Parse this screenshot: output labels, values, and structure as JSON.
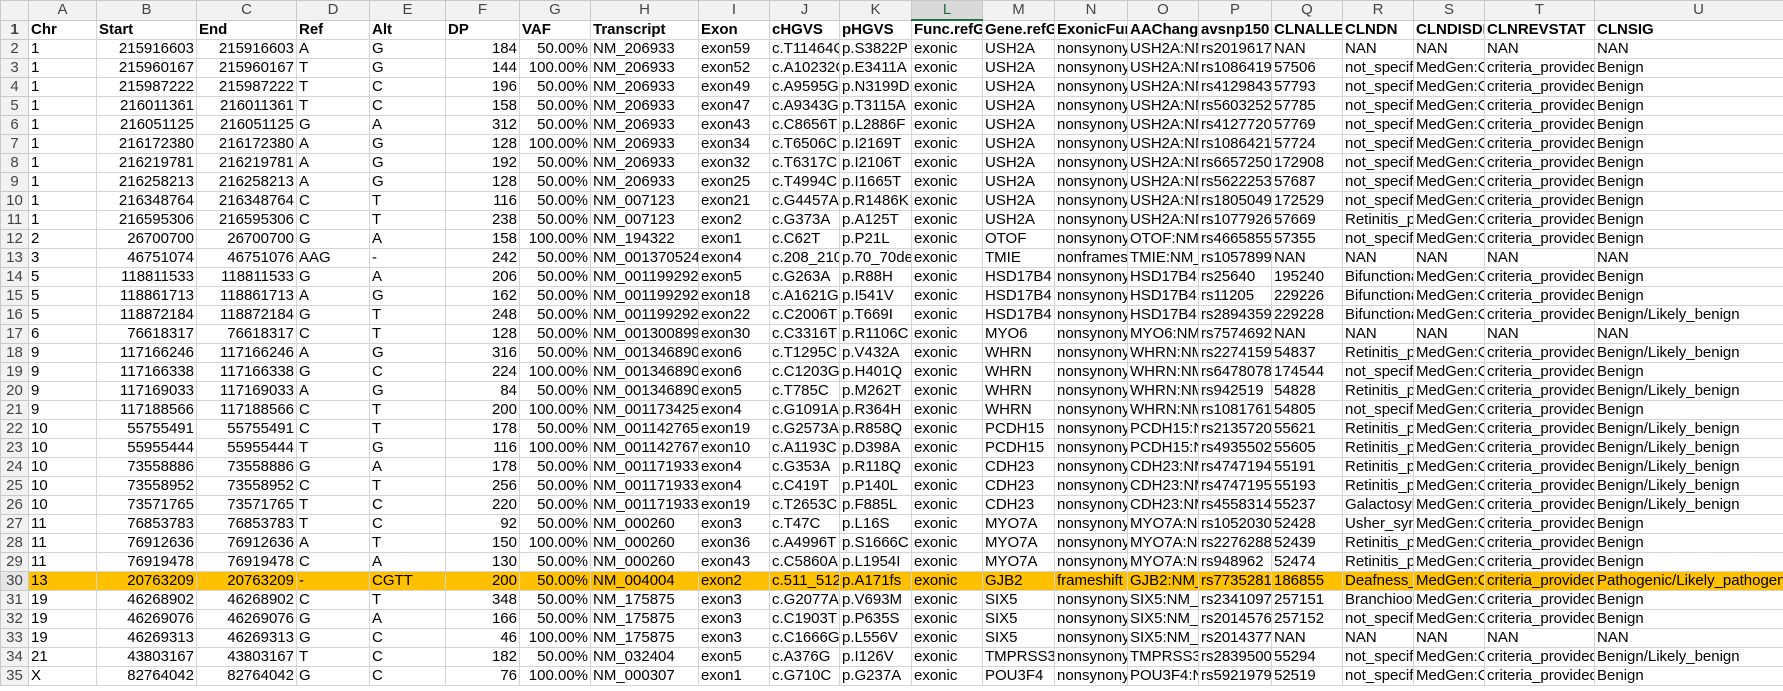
{
  "columns": [
    "A",
    "B",
    "C",
    "D",
    "E",
    "F",
    "G",
    "H",
    "I",
    "J",
    "K",
    "L",
    "M",
    "N",
    "O",
    "P",
    "Q",
    "R",
    "S",
    "T",
    "U"
  ],
  "selected_column": "L",
  "highlight_row": 30,
  "highlight_color": "#ffc000",
  "numeric_columns": [
    1,
    2,
    5,
    6
  ],
  "rows": [
    [
      "Chr",
      "Start",
      "End",
      "Ref",
      "Alt",
      "DP",
      "VAF",
      "Transcript",
      "Exon",
      "cHGVS",
      "pHGVS",
      "Func.refGe",
      "Gene.refGe",
      "ExonicFun",
      "AAChange",
      "avsnp150",
      "CLNALLEL",
      "CLNDN",
      "CLNDISDB",
      "CLNREVSTAT",
      "CLNSIG"
    ],
    [
      "1",
      "215916603",
      "215916603",
      "A",
      "G",
      "184",
      "50.00%",
      "NM_206933",
      "exon59",
      "c.T11464C",
      "p.S3822P",
      "exonic",
      "USH2A",
      "nonsynony",
      "USH2A:NM",
      "rs2019617",
      "NAN",
      "NAN",
      "NAN",
      "NAN",
      "NAN"
    ],
    [
      "1",
      "215960167",
      "215960167",
      "T",
      "G",
      "144",
      "100.00%",
      "NM_206933",
      "exon52",
      "c.A10232C",
      "p.E3411A",
      "exonic",
      "USH2A",
      "nonsynony",
      "USH2A:NM",
      "rs1086419",
      "57506",
      "not_specifi",
      "MedGen:C",
      "criteria_provided",
      "Benign"
    ],
    [
      "1",
      "215987222",
      "215987222",
      "T",
      "C",
      "196",
      "50.00%",
      "NM_206933",
      "exon49",
      "c.A9595G",
      "p.N3199D",
      "exonic",
      "USH2A",
      "nonsynony",
      "USH2A:NM",
      "rs4129843",
      "57793",
      "not_specifi",
      "MedGen:C",
      "criteria_provided",
      "Benign"
    ],
    [
      "1",
      "216011361",
      "216011361",
      "T",
      "C",
      "158",
      "50.00%",
      "NM_206933",
      "exon47",
      "c.A9343G",
      "p.T3115A",
      "exonic",
      "USH2A",
      "nonsynony",
      "USH2A:NM",
      "rs5603252",
      "57785",
      "not_specifi",
      "MedGen:C",
      "criteria_provided",
      "Benign"
    ],
    [
      "1",
      "216051125",
      "216051125",
      "G",
      "A",
      "312",
      "50.00%",
      "NM_206933",
      "exon43",
      "c.C8656T",
      "p.L2886F",
      "exonic",
      "USH2A",
      "nonsynony",
      "USH2A:NM",
      "rs4127720",
      "57769",
      "not_specifi",
      "MedGen:C",
      "criteria_provided",
      "Benign"
    ],
    [
      "1",
      "216172380",
      "216172380",
      "A",
      "G",
      "128",
      "100.00%",
      "NM_206933",
      "exon34",
      "c.T6506C",
      "p.I2169T",
      "exonic",
      "USH2A",
      "nonsynony",
      "USH2A:NM",
      "rs1086421",
      "57724",
      "not_specifi",
      "MedGen:C",
      "criteria_provided",
      "Benign"
    ],
    [
      "1",
      "216219781",
      "216219781",
      "A",
      "G",
      "192",
      "50.00%",
      "NM_206933",
      "exon32",
      "c.T6317C",
      "p.I2106T",
      "exonic",
      "USH2A",
      "nonsynony",
      "USH2A:NM",
      "rs6657250",
      "172908",
      "not_specifi",
      "MedGen:C",
      "criteria_provided",
      "Benign"
    ],
    [
      "1",
      "216258213",
      "216258213",
      "A",
      "G",
      "128",
      "50.00%",
      "NM_206933",
      "exon25",
      "c.T4994C",
      "p.I1665T",
      "exonic",
      "USH2A",
      "nonsynony",
      "USH2A:NM",
      "rs5622253",
      "57687",
      "not_specifi",
      "MedGen:C",
      "criteria_provided",
      "Benign"
    ],
    [
      "1",
      "216348764",
      "216348764",
      "C",
      "T",
      "116",
      "50.00%",
      "NM_007123",
      "exon21",
      "c.G4457A",
      "p.R1486K",
      "exonic",
      "USH2A",
      "nonsynony",
      "USH2A:NM",
      "rs1805049",
      "172529",
      "not_specifi",
      "MedGen:C",
      "criteria_provided",
      "Benign"
    ],
    [
      "1",
      "216595306",
      "216595306",
      "C",
      "T",
      "238",
      "50.00%",
      "NM_007123",
      "exon2",
      "c.G373A",
      "p.A125T",
      "exonic",
      "USH2A",
      "nonsynony",
      "USH2A:NM",
      "rs1077926",
      "57669",
      "Retinitis_pi",
      "MedGen:C",
      "criteria_provided",
      "Benign"
    ],
    [
      "2",
      "26700700",
      "26700700",
      "G",
      "A",
      "158",
      "100.00%",
      "NM_194322",
      "exon1",
      "c.C62T",
      "p.P21L",
      "exonic",
      "OTOF",
      "nonsynony",
      "OTOF:NM_",
      "rs4665855",
      "57355",
      "not_specifi",
      "MedGen:C",
      "criteria_provided",
      "Benign"
    ],
    [
      "3",
      "46751074",
      "46751076",
      "AAG",
      "-",
      "242",
      "50.00%",
      "NM_001370524",
      "exon4",
      "c.208_210d",
      "p.70_70del",
      "exonic",
      "TMIE",
      "nonframes",
      "TMIE:NM_",
      "rs1057899",
      "NAN",
      "NAN",
      "NAN",
      "NAN",
      "NAN"
    ],
    [
      "5",
      "118811533",
      "118811533",
      "G",
      "A",
      "206",
      "50.00%",
      "NM_001199292",
      "exon5",
      "c.G263A",
      "p.R88H",
      "exonic",
      "HSD17B4",
      "nonsynony",
      "HSD17B4:N",
      "rs25640",
      "195240",
      "Bifunctiona",
      "MedGen:C",
      "criteria_provided",
      "Benign"
    ],
    [
      "5",
      "118861713",
      "118861713",
      "A",
      "G",
      "162",
      "50.00%",
      "NM_001199292",
      "exon18",
      "c.A1621G",
      "p.I541V",
      "exonic",
      "HSD17B4",
      "nonsynony",
      "HSD17B4:N",
      "rs11205",
      "229226",
      "Bifunctiona",
      "MedGen:C",
      "criteria_provided",
      "Benign"
    ],
    [
      "5",
      "118872184",
      "118872184",
      "G",
      "T",
      "248",
      "50.00%",
      "NM_001199292",
      "exon22",
      "c.C2006T",
      "p.T669I",
      "exonic",
      "HSD17B4",
      "nonsynony",
      "HSD17B4:N",
      "rs2894359",
      "229228",
      "Bifunctiona",
      "MedGen:C",
      "criteria_provided",
      "Benign/Likely_benign"
    ],
    [
      "6",
      "76618317",
      "76618317",
      "C",
      "T",
      "128",
      "50.00%",
      "NM_001300899",
      "exon30",
      "c.C3316T",
      "p.R1106C",
      "exonic",
      "MYO6",
      "nonsynony",
      "MYO6:NM_",
      "rs7574692",
      "NAN",
      "NAN",
      "NAN",
      "NAN",
      "NAN"
    ],
    [
      "9",
      "117166246",
      "117166246",
      "A",
      "G",
      "316",
      "50.00%",
      "NM_001346890",
      "exon6",
      "c.T1295C",
      "p.V432A",
      "exonic",
      "WHRN",
      "nonsynony",
      "WHRN:NM",
      "rs2274159",
      "54837",
      "Retinitis_pi",
      "MedGen:C",
      "criteria_provided",
      "Benign/Likely_benign"
    ],
    [
      "9",
      "117166338",
      "117166338",
      "G",
      "C",
      "224",
      "100.00%",
      "NM_001346890",
      "exon6",
      "c.C1203G",
      "p.H401Q",
      "exonic",
      "WHRN",
      "nonsynony",
      "WHRN:NM",
      "rs6478078",
      "174544",
      "not_specifi",
      "MedGen:C",
      "criteria_provided",
      "Benign"
    ],
    [
      "9",
      "117169033",
      "117169033",
      "A",
      "G",
      "84",
      "50.00%",
      "NM_001346890",
      "exon5",
      "c.T785C",
      "p.M262T",
      "exonic",
      "WHRN",
      "nonsynony",
      "WHRN:NM",
      "rs942519",
      "54828",
      "Retinitis_pi",
      "MedGen:C",
      "criteria_provided",
      "Benign/Likely_benign"
    ],
    [
      "9",
      "117188566",
      "117188566",
      "C",
      "T",
      "200",
      "100.00%",
      "NM_001173425",
      "exon4",
      "c.G1091A",
      "p.R364H",
      "exonic",
      "WHRN",
      "nonsynony",
      "WHRN:NM",
      "rs1081761",
      "54805",
      "not_specifi",
      "MedGen:C",
      "criteria_provided",
      "Benign"
    ],
    [
      "10",
      "55755491",
      "55755491",
      "C",
      "T",
      "178",
      "50.00%",
      "NM_001142765",
      "exon19",
      "c.G2573A",
      "p.R858Q",
      "exonic",
      "PCDH15",
      "nonsynony",
      "PCDH15:NM",
      "rs2135720",
      "55621",
      "Retinitis_pi",
      "MedGen:C",
      "criteria_provided",
      "Benign/Likely_benign"
    ],
    [
      "10",
      "55955444",
      "55955444",
      "T",
      "G",
      "116",
      "100.00%",
      "NM_001142767",
      "exon10",
      "c.A1193C",
      "p.D398A",
      "exonic",
      "PCDH15",
      "nonsynony",
      "PCDH15:NM",
      "rs4935502",
      "55605",
      "Retinitis_pi",
      "MedGen:C",
      "criteria_provided",
      "Benign/Likely_benign"
    ],
    [
      "10",
      "73558886",
      "73558886",
      "G",
      "A",
      "178",
      "50.00%",
      "NM_001171933",
      "exon4",
      "c.G353A",
      "p.R118Q",
      "exonic",
      "CDH23",
      "nonsynony",
      "CDH23:NM",
      "rs4747194",
      "55191",
      "Retinitis_pi",
      "MedGen:C",
      "criteria_provided",
      "Benign/Likely_benign"
    ],
    [
      "10",
      "73558952",
      "73558952",
      "C",
      "T",
      "256",
      "50.00%",
      "NM_001171933",
      "exon4",
      "c.C419T",
      "p.P140L",
      "exonic",
      "CDH23",
      "nonsynony",
      "CDH23:NM",
      "rs4747195",
      "55193",
      "Retinitis_pi",
      "MedGen:C",
      "criteria_provided",
      "Benign/Likely_benign"
    ],
    [
      "10",
      "73571765",
      "73571765",
      "T",
      "C",
      "220",
      "50.00%",
      "NM_001171933",
      "exon19",
      "c.T2653C",
      "p.F885L",
      "exonic",
      "CDH23",
      "nonsynony",
      "CDH23:NM",
      "rs4558314",
      "55237",
      "Galactosyl",
      "MedGen:C",
      "criteria_provided",
      "Benign/Likely_benign"
    ],
    [
      "11",
      "76853783",
      "76853783",
      "T",
      "C",
      "92",
      "50.00%",
      "NM_000260",
      "exon3",
      "c.T47C",
      "p.L16S",
      "exonic",
      "MYO7A",
      "nonsynony",
      "MYO7A:NM",
      "rs1052030",
      "52428",
      "Usher_synd",
      "MedGen:C",
      "criteria_provided",
      "Benign"
    ],
    [
      "11",
      "76912636",
      "76912636",
      "A",
      "T",
      "150",
      "100.00%",
      "NM_000260",
      "exon36",
      "c.A4996T",
      "p.S1666C",
      "exonic",
      "MYO7A",
      "nonsynony",
      "MYO7A:NM",
      "rs2276288",
      "52439",
      "Retinitis_pi",
      "MedGen:C",
      "criteria_provided",
      "Benign"
    ],
    [
      "11",
      "76919478",
      "76919478",
      "C",
      "A",
      "130",
      "50.00%",
      "NM_000260",
      "exon43",
      "c.C5860A",
      "p.L1954I",
      "exonic",
      "MYO7A",
      "nonsynony",
      "MYO7A:NM",
      "rs948962",
      "52474",
      "Retinitis_pi",
      "MedGen:C",
      "criteria_provided",
      "Benign"
    ],
    [
      "13",
      "20763209",
      "20763209",
      "-",
      "CGTT",
      "200",
      "50.00%",
      "NM_004004",
      "exon2",
      "c.511_512i",
      "p.A171fs",
      "exonic",
      "GJB2",
      "frameshift",
      "GJB2:NM_0",
      "rs7735281",
      "186855",
      "Deafness_",
      "MedGen:C",
      "criteria_provided",
      "Pathogenic/Likely_pathogenic"
    ],
    [
      "19",
      "46268902",
      "46268902",
      "C",
      "T",
      "348",
      "50.00%",
      "NM_175875",
      "exon3",
      "c.G2077A",
      "p.V693M",
      "exonic",
      "SIX5",
      "nonsynony",
      "SIX5:NM_1",
      "rs2341097",
      "257151",
      "Branchioot",
      "MedGen:C",
      "criteria_provided",
      "Benign"
    ],
    [
      "19",
      "46269076",
      "46269076",
      "G",
      "A",
      "166",
      "50.00%",
      "NM_175875",
      "exon3",
      "c.C1903T",
      "p.P635S",
      "exonic",
      "SIX5",
      "nonsynony",
      "SIX5:NM_1",
      "rs2014576",
      "257152",
      "not_specifi",
      "MedGen:C",
      "criteria_provided",
      "Benign"
    ],
    [
      "19",
      "46269313",
      "46269313",
      "G",
      "C",
      "46",
      "100.00%",
      "NM_175875",
      "exon3",
      "c.C1666G",
      "p.L556V",
      "exonic",
      "SIX5",
      "nonsynony",
      "SIX5:NM_1",
      "rs2014377",
      "NAN",
      "NAN",
      "NAN",
      "NAN",
      "NAN"
    ],
    [
      "21",
      "43803167",
      "43803167",
      "T",
      "C",
      "182",
      "50.00%",
      "NM_032404",
      "exon5",
      "c.A376G",
      "p.I126V",
      "exonic",
      "TMPRSS3",
      "nonsynony",
      "TMPRSS3:N",
      "rs2839500",
      "55294",
      "not_specifi",
      "MedGen:C",
      "criteria_provided",
      "Benign/Likely_benign"
    ],
    [
      "X",
      "82764042",
      "82764042",
      "G",
      "C",
      "76",
      "100.00%",
      "NM_000307",
      "exon1",
      "c.G710C",
      "p.G237A",
      "exonic",
      "POU3F4",
      "nonsynony",
      "POU3F4:N",
      "rs5921979",
      "52519",
      "not_specifi",
      "MedGen:C",
      "criteria_provided",
      "Benign"
    ]
  ]
}
